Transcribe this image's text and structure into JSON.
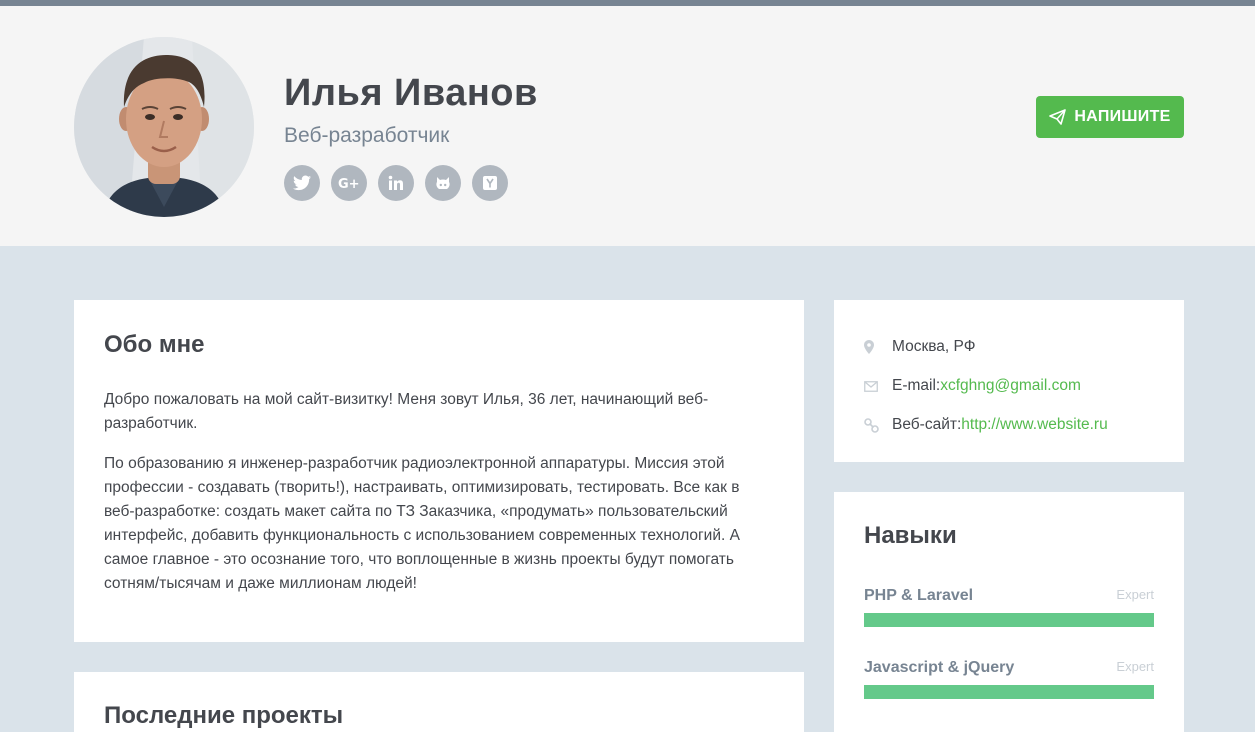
{
  "header": {
    "name": "Илья Иванов",
    "role": "Веб-разработчик",
    "socials": [
      "twitter-icon",
      "google-plus-icon",
      "linkedin-icon",
      "github-icon",
      "hacker-news-icon"
    ],
    "cta_label": "НАПИШИТЕ"
  },
  "about": {
    "title": "Обо мне",
    "paragraph1": "Добро пожаловать на мой сайт-визитку! Меня зовут Илья, 36 лет, начинающий веб-разработчик.",
    "paragraph2": "По образованию я инженер-разработчик радиоэлектронной аппаратуры. Миссия этой профессии - создавать (творить!), настраивать, оптимизировать, тестировать. Все как в веб-разработке: создать макет сайта по ТЗ Заказчика, «продумать» пользовательский интерфейс, добавить функциональность с использованием современных технологий. А самое главное - это осознание того, что воплощенные в жизнь проекты будут помогать сотням/тысячам и даже миллионам людей!"
  },
  "projects": {
    "title": "Последние проекты"
  },
  "info": {
    "location": "Москва, РФ",
    "email_label": "E-mail:",
    "email_value": "xcfghng@gmail.com",
    "website_label": "Веб-сайт:",
    "website_value": "http://www.website.ru"
  },
  "skills": {
    "title": "Навыки",
    "items": [
      {
        "name": "PHP & Laravel",
        "level": "Expert",
        "progress": 1.0
      },
      {
        "name": "Javascript & jQuery",
        "level": "Expert",
        "progress": 1.0
      }
    ]
  },
  "colors": {
    "accent": "#54ba4e",
    "progress": "#64c98a",
    "header_bg": "#f5f5f5",
    "page_bg": "#dae3ea"
  }
}
